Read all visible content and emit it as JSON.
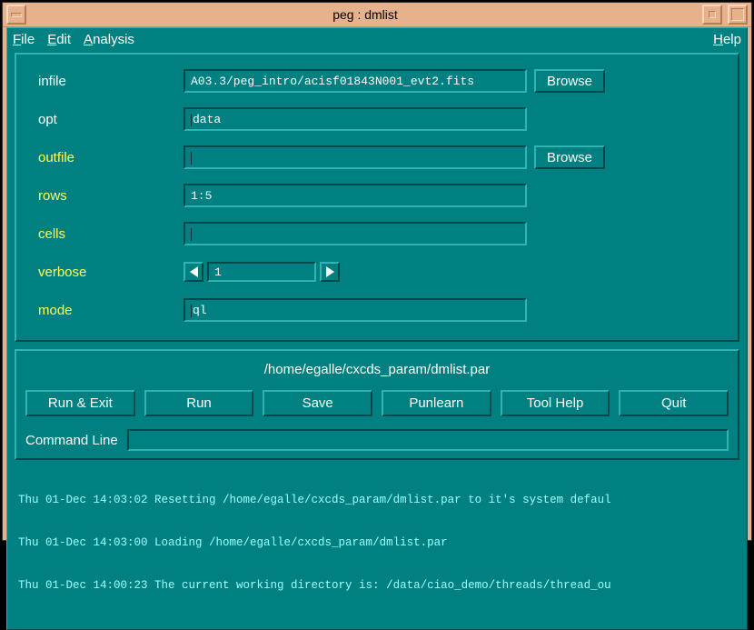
{
  "window": {
    "title": "peg : dmlist"
  },
  "menu": {
    "file": "File",
    "edit": "Edit",
    "analysis": "Analysis",
    "help": "Help"
  },
  "params": {
    "infile": {
      "label": "infile",
      "value": "A03.3/peg_intro/acisf01843N001_evt2.fits",
      "browse": "Browse"
    },
    "opt": {
      "label": "opt",
      "value": "data"
    },
    "outfile": {
      "label": "outfile",
      "value": "",
      "browse": "Browse"
    },
    "rows": {
      "label": "rows",
      "value": "1:5"
    },
    "cells": {
      "label": "cells",
      "value": ""
    },
    "verbose": {
      "label": "verbose",
      "value": "1"
    },
    "mode": {
      "label": "mode",
      "value": "ql"
    }
  },
  "footer": {
    "parfile_path": "/home/egalle/cxcds_param/dmlist.par",
    "buttons": {
      "run_exit": "Run & Exit",
      "run": "Run",
      "save": "Save",
      "punlearn": "Punlearn",
      "tool_help": "Tool Help",
      "quit": "Quit"
    },
    "cmdline_label": "Command Line",
    "cmdline_value": ""
  },
  "log": {
    "l1": "Thu 01-Dec 14:03:02 Resetting /home/egalle/cxcds_param/dmlist.par to it's system defaul",
    "l2": "Thu 01-Dec 14:03:00 Loading /home/egalle/cxcds_param/dmlist.par",
    "l3": "Thu 01-Dec 14:00:23 The current working directory is: /data/ciao_demo/threads/thread_ou"
  }
}
